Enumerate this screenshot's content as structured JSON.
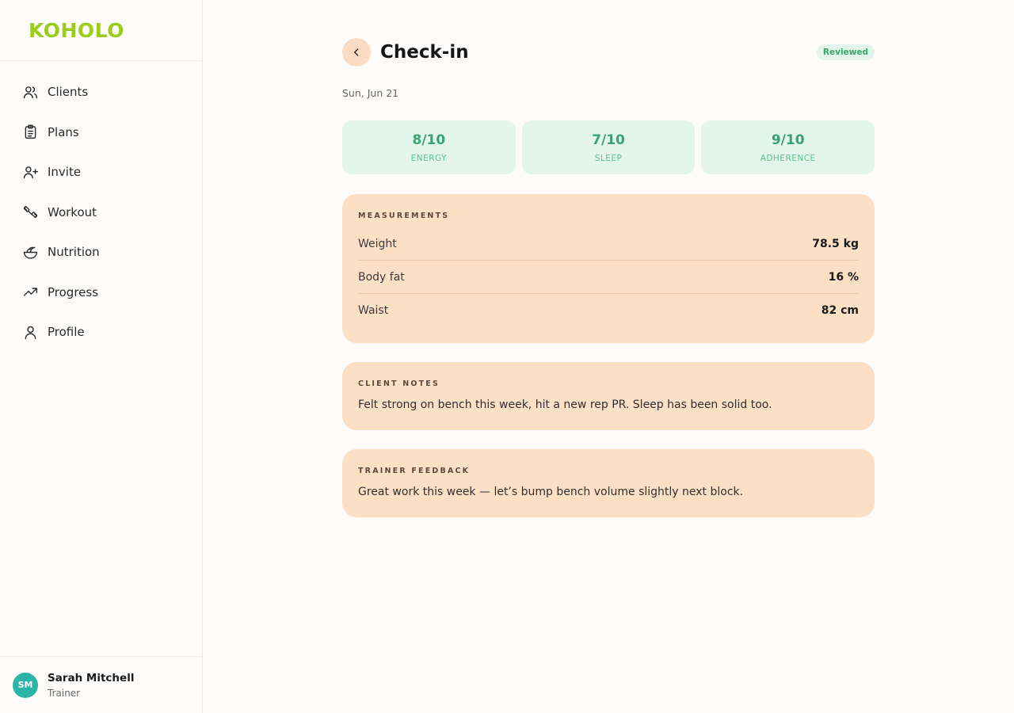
{
  "brand": {
    "logo": "KOHOLO",
    "color": "#9ccc1c"
  },
  "sidebar": {
    "items": [
      {
        "label": "Clients",
        "icon": "users-icon"
      },
      {
        "label": "Plans",
        "icon": "clipboard-icon"
      },
      {
        "label": "Invite",
        "icon": "user-plus-icon"
      },
      {
        "label": "Workout",
        "icon": "dumbbell-icon"
      },
      {
        "label": "Nutrition",
        "icon": "salad-bowl-icon"
      },
      {
        "label": "Progress",
        "icon": "trending-up-icon"
      },
      {
        "label": "Profile",
        "icon": "user-icon"
      }
    ]
  },
  "user": {
    "initials": "SM",
    "name": "Sarah Mitchell",
    "role": "Trainer",
    "avatar_color": "#2cb5a6"
  },
  "header": {
    "title": "Check-in",
    "status": "Reviewed",
    "date": "Sun, Jun 21",
    "back_icon": "chevron-left-icon"
  },
  "stats": [
    {
      "value": "8/10",
      "label": "ENERGY"
    },
    {
      "value": "7/10",
      "label": "SLEEP"
    },
    {
      "value": "9/10",
      "label": "ADHERENCE"
    }
  ],
  "measurements": {
    "heading": "MEASUREMENTS",
    "rows": [
      {
        "label": "Weight",
        "value": "78.5 kg"
      },
      {
        "label": "Body fat",
        "value": "16 %"
      },
      {
        "label": "Waist",
        "value": "82 cm"
      }
    ]
  },
  "client_notes": {
    "heading": "CLIENT NOTES",
    "text": "Felt strong on bench this week, hit a new rep PR. Sleep has been solid too."
  },
  "trainer_feedback": {
    "heading": "TRAINER FEEDBACK",
    "text": "Great work this week — let’s bump bench volume slightly next block."
  },
  "colors": {
    "accent_peach": "#fce0c6",
    "stat_green_bg": "#e4f6ec",
    "stat_green_text": "#3aa271",
    "badge_bg": "#e3f5ea",
    "badge_text": "#37a76a"
  }
}
